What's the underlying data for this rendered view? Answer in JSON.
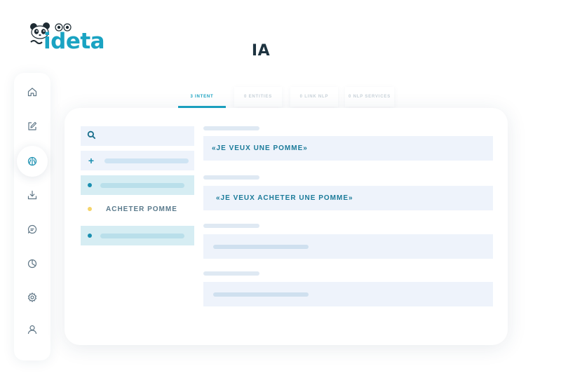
{
  "brand": {
    "name": "ideta",
    "accent": "#1aa3c2"
  },
  "page": {
    "title": "IA"
  },
  "sidebar": {
    "items": [
      {
        "icon": "home-icon"
      },
      {
        "icon": "edit-icon"
      },
      {
        "icon": "brain-icon",
        "active": true
      },
      {
        "icon": "download-icon"
      },
      {
        "icon": "chat-search-icon"
      },
      {
        "icon": "pie-chart-icon"
      },
      {
        "icon": "settings-icon"
      },
      {
        "icon": "user-icon"
      }
    ]
  },
  "tabs": [
    {
      "label": "3 INTENT",
      "active": true
    },
    {
      "label": "0 ENTITIES"
    },
    {
      "label": "0 LINK NLP"
    },
    {
      "label": "0 NLP SERVICES"
    }
  ],
  "intents": {
    "search_icon": "search-icon",
    "add_icon": "plus-icon",
    "selected_label": "ACHETER POMME"
  },
  "phrases": [
    "«JE VEUX UNE POMME»",
    "«JE VEUX ACHETER UNE POMME»"
  ],
  "colors": {
    "list_highlight": "#d6edf3",
    "phrase_bg": "#eef3fb",
    "dot_teal": "#1a8fb0",
    "dot_yellow": "#f5d46a"
  }
}
